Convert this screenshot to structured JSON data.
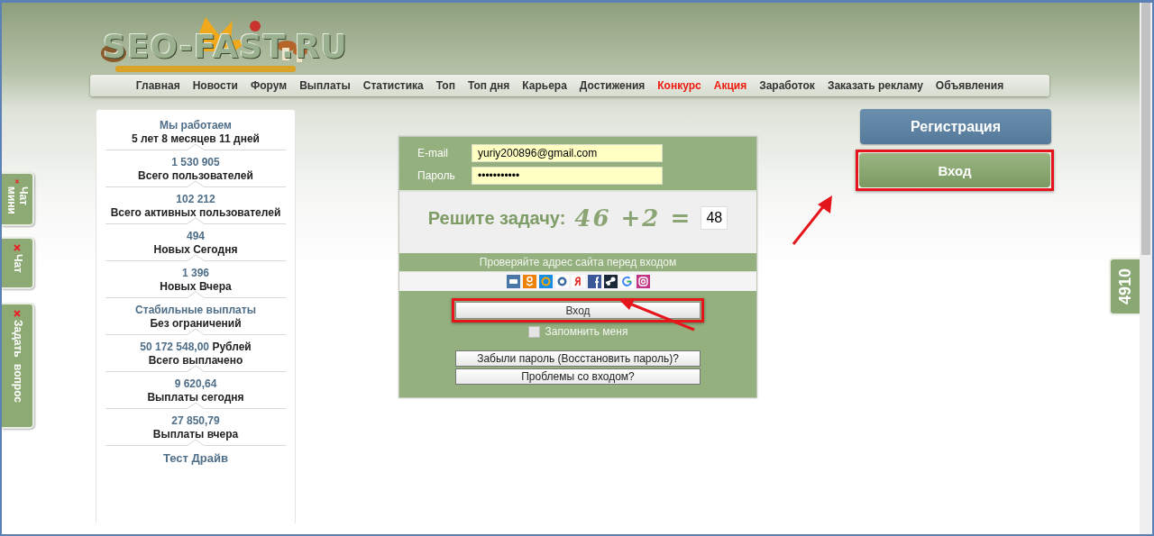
{
  "logo": {
    "text": "SEO-FAST.RU"
  },
  "nav": [
    {
      "label": "Главная",
      "hot": false
    },
    {
      "label": "Новости",
      "hot": false
    },
    {
      "label": "Форум",
      "hot": false
    },
    {
      "label": "Выплаты",
      "hot": false
    },
    {
      "label": "Статистика",
      "hot": false
    },
    {
      "label": "Топ",
      "hot": false
    },
    {
      "label": "Топ дня",
      "hot": false
    },
    {
      "label": "Карьера",
      "hot": false
    },
    {
      "label": "Достижения",
      "hot": false
    },
    {
      "label": "Конкурс",
      "hot": true
    },
    {
      "label": "Акция",
      "hot": true
    },
    {
      "label": "Заработок",
      "hot": false
    },
    {
      "label": "Заказать рекламу",
      "hot": false
    },
    {
      "label": "Объявления",
      "hot": false
    }
  ],
  "side_tabs": [
    {
      "label": "Чат мини"
    },
    {
      "label": "Чат"
    },
    {
      "label": "Задать вопрос"
    }
  ],
  "stats": [
    {
      "value": "Мы работаем",
      "label": "5 лет 8 месяцев 11 дней"
    },
    {
      "value": "1 530 905",
      "label": "Всего пользователей"
    },
    {
      "value": "102 212",
      "label": "Всего активных пользователей"
    },
    {
      "value": "494",
      "label": "Новых Сегодня"
    },
    {
      "value": "1 396",
      "label": "Новых Вчера"
    },
    {
      "value": "Стабильные выплаты",
      "label": "Без ограничений"
    },
    {
      "value": "50 172 548,00 **Рублей**",
      "label": "Всего выплачено"
    },
    {
      "value": "9 620,64",
      "label": "Выплаты сегодня"
    },
    {
      "value": "27 850,79",
      "label": "Выплаты вчера"
    },
    {
      "value": "Тест Драйв"
    }
  ],
  "login_form": {
    "fields": [
      {
        "label": "E-mail",
        "value": "yuriy200896@gmail.com"
      },
      {
        "label": "Пароль",
        "value": "•••••••••••"
      }
    ],
    "captcha": {
      "title": "Решите задачу:",
      "expression": "46 +2 =",
      "answer": "48"
    },
    "notice": "Проверяйте адрес сайта перед входом",
    "social_icons": [
      {
        "color": "#4a76a8"
      },
      {
        "color": "#ee8208"
      },
      {
        "color": "#168de2"
      },
      {
        "color": "#ffffff"
      },
      {
        "color": "#ffffff"
      },
      {
        "color": "#3b5998"
      },
      {
        "color": "#1b2838"
      },
      {
        "color": "#ffffff"
      },
      {
        "color": "#c13584"
      }
    ],
    "submit": "Вход",
    "remember": {
      "label": "Запомнить меня",
      "checked": false
    },
    "links": [
      "Забыли пароль (Восстановить пароль)?",
      "Проблемы со входом?"
    ]
  },
  "register_button": "Регистрация",
  "login_button": "Вход",
  "counter": "4910"
}
